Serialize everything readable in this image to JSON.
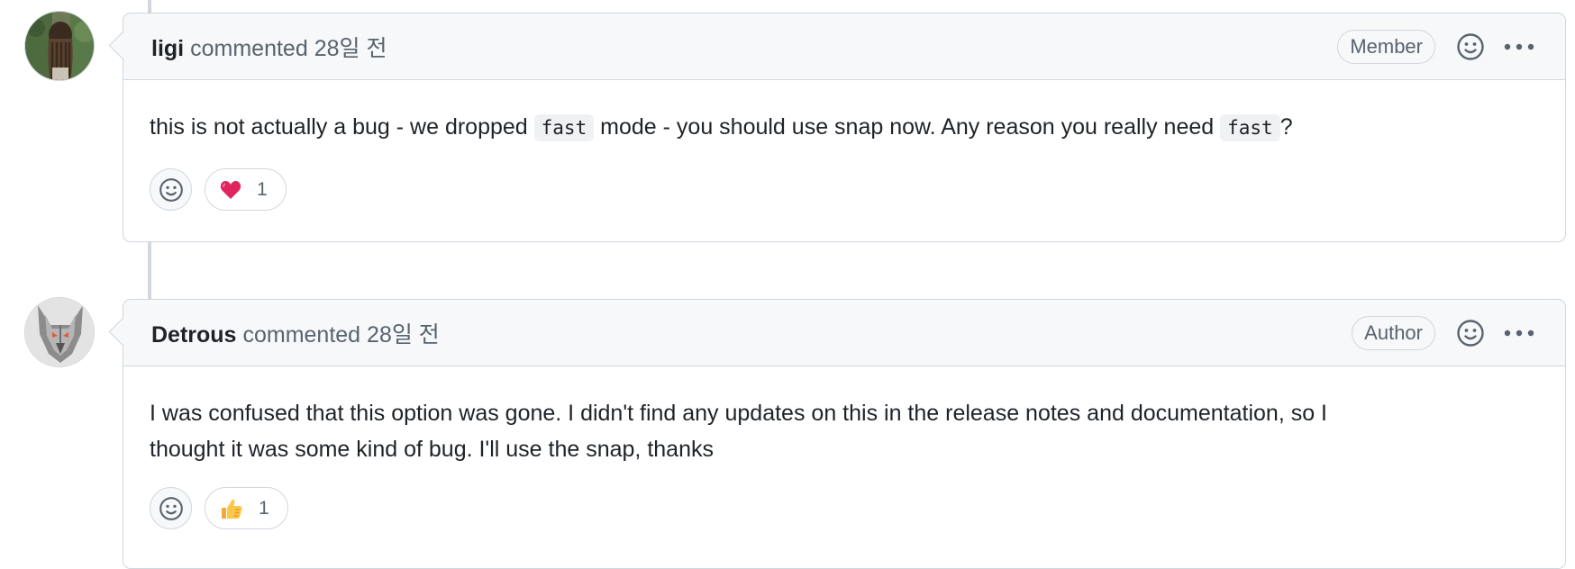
{
  "comments": [
    {
      "author": "ligi",
      "action": "commented",
      "time": "28일 전",
      "role": "Member",
      "avatar_icon": "dreadlocks-person-avatar",
      "body_parts": [
        "this is not actually a bug - we dropped ",
        "fast",
        " mode - you should use snap now. Any reason you really need ",
        "fast",
        "?"
      ],
      "reactions": [
        {
          "emoji_icon": "red-heart-icon",
          "count": "1"
        }
      ]
    },
    {
      "author": "Detrous",
      "action": "commented",
      "time": "28일 전",
      "role": "Author",
      "avatar_icon": "wolf-mask-avatar",
      "body_lines": [
        "I was confused that this option was gone. I didn't find any updates on this in the release notes and documentation, so I",
        "thought it was some kind of bug. I'll use the snap, thanks"
      ],
      "reactions": [
        {
          "emoji_icon": "thumbs-up-icon",
          "count": "1"
        }
      ]
    }
  ],
  "colors": {
    "border": "#d0d7de",
    "header_bg": "#f6f8fa",
    "muted_text": "#59636e",
    "code_bg": "#eff1f3"
  }
}
